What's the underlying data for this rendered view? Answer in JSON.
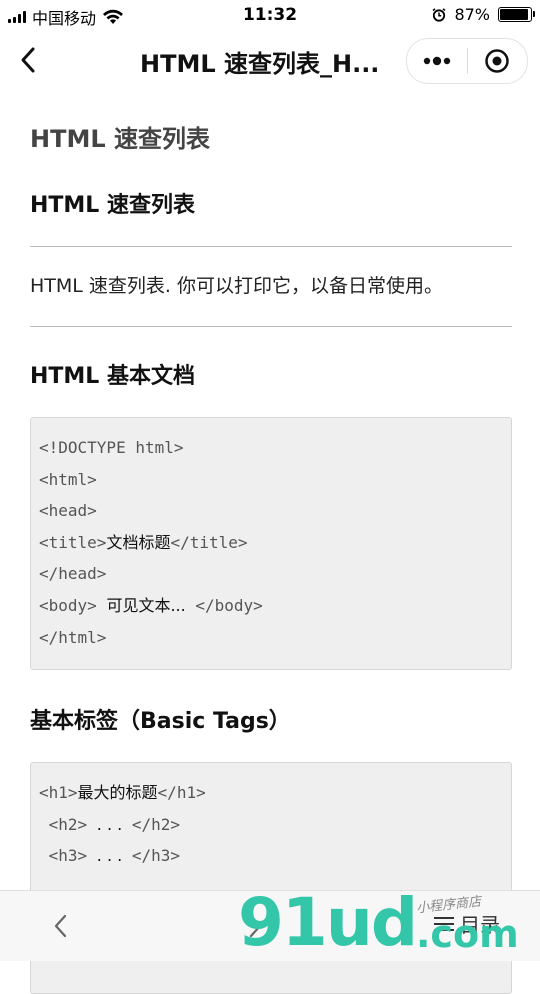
{
  "status_bar": {
    "carrier": "中国移动",
    "time": "11:32",
    "battery_percent": "87%",
    "battery_level": 0.87
  },
  "nav": {
    "title": "HTML 速查列表_H...",
    "more_icon": "more-dots-icon",
    "close_icon": "target-circle-icon"
  },
  "content": {
    "page_title": "HTML 速查列表",
    "section1_title": "HTML 速查列表",
    "description": "HTML 速查列表. 你可以打印它，以备日常使用。",
    "section2_title": "HTML 基本文档",
    "code1": [
      {
        "tag": "<!DOCTYPE html>",
        "text": "",
        "tag2": ""
      },
      {
        "tag": "<html>",
        "text": "",
        "tag2": ""
      },
      {
        "tag": "<head>",
        "text": "",
        "tag2": ""
      },
      {
        "tag": "<title>",
        "text": "文档标题",
        "tag2": "</title>"
      },
      {
        "tag": "</head>",
        "text": "",
        "tag2": ""
      },
      {
        "tag": "<body> ",
        "text": "可见文本...",
        "tag2": " </body>"
      },
      {
        "tag": "</html>",
        "text": "",
        "tag2": ""
      }
    ],
    "section3_title": "基本标签（Basic Tags）",
    "code2": [
      {
        "tag": "<h1>",
        "text": "最大的标题",
        "tag2": "</h1>"
      },
      {
        "tag": " <h2> ",
        "text": ". . .",
        "tag2": " </h2>"
      },
      {
        "tag": " <h3> ",
        "text": ". . .",
        "tag2": " </h3>"
      }
    ]
  },
  "bottom_bar": {
    "toc_label": "目录"
  },
  "watermark": {
    "main": "91ud",
    "domain": ".com",
    "tagline": "小程序商店"
  },
  "colors": {
    "watermark": "#33c6a8",
    "code_bg": "#efefef"
  }
}
